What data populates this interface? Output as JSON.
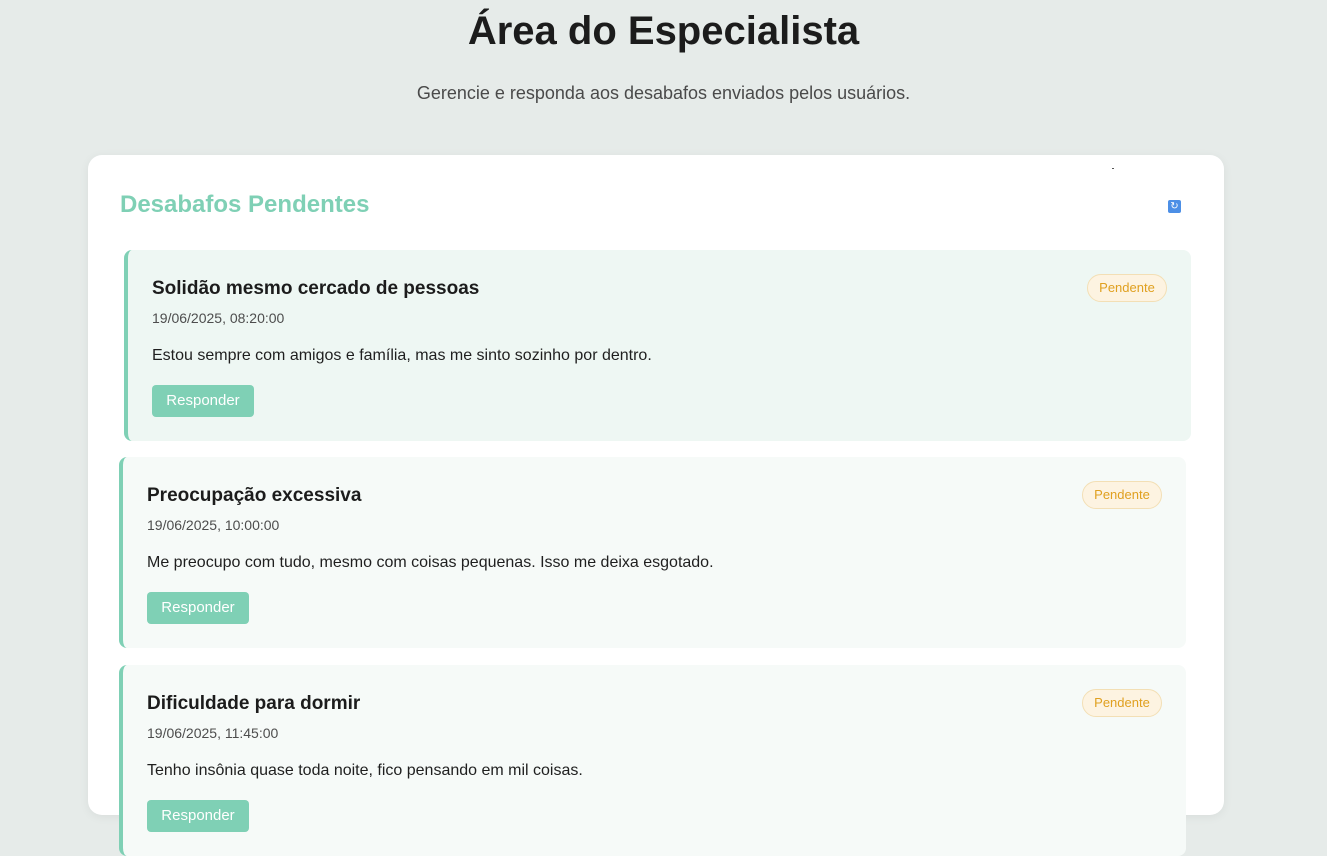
{
  "header": {
    "title": "Área do Especialista",
    "subtitle": "Gerencie e responda aos desabafos enviados pelos usuários."
  },
  "panel": {
    "title": "Desabafos Pendentes",
    "refresh_icon": "refresh-icon",
    "accent_color": "#7fd0b5"
  },
  "items": [
    {
      "title": "Solidão mesmo cercado de pessoas",
      "date": "19/06/2025, 08:20:00",
      "text": "Estou sempre com amigos e família, mas me sinto sozinho por dentro.",
      "status": "Pendente",
      "button": "Responder"
    },
    {
      "title": "Preocupação excessiva",
      "date": "19/06/2025, 10:00:00",
      "text": "Me preocupo com tudo, mesmo com coisas pequenas. Isso me deixa esgotado.",
      "status": "Pendente",
      "button": "Responder"
    },
    {
      "title": "Dificuldade para dormir",
      "date": "19/06/2025, 11:45:00",
      "text": "Tenho insônia quase toda noite, fico pensando em mil coisas.",
      "status": "Pendente",
      "button": "Responder"
    }
  ]
}
